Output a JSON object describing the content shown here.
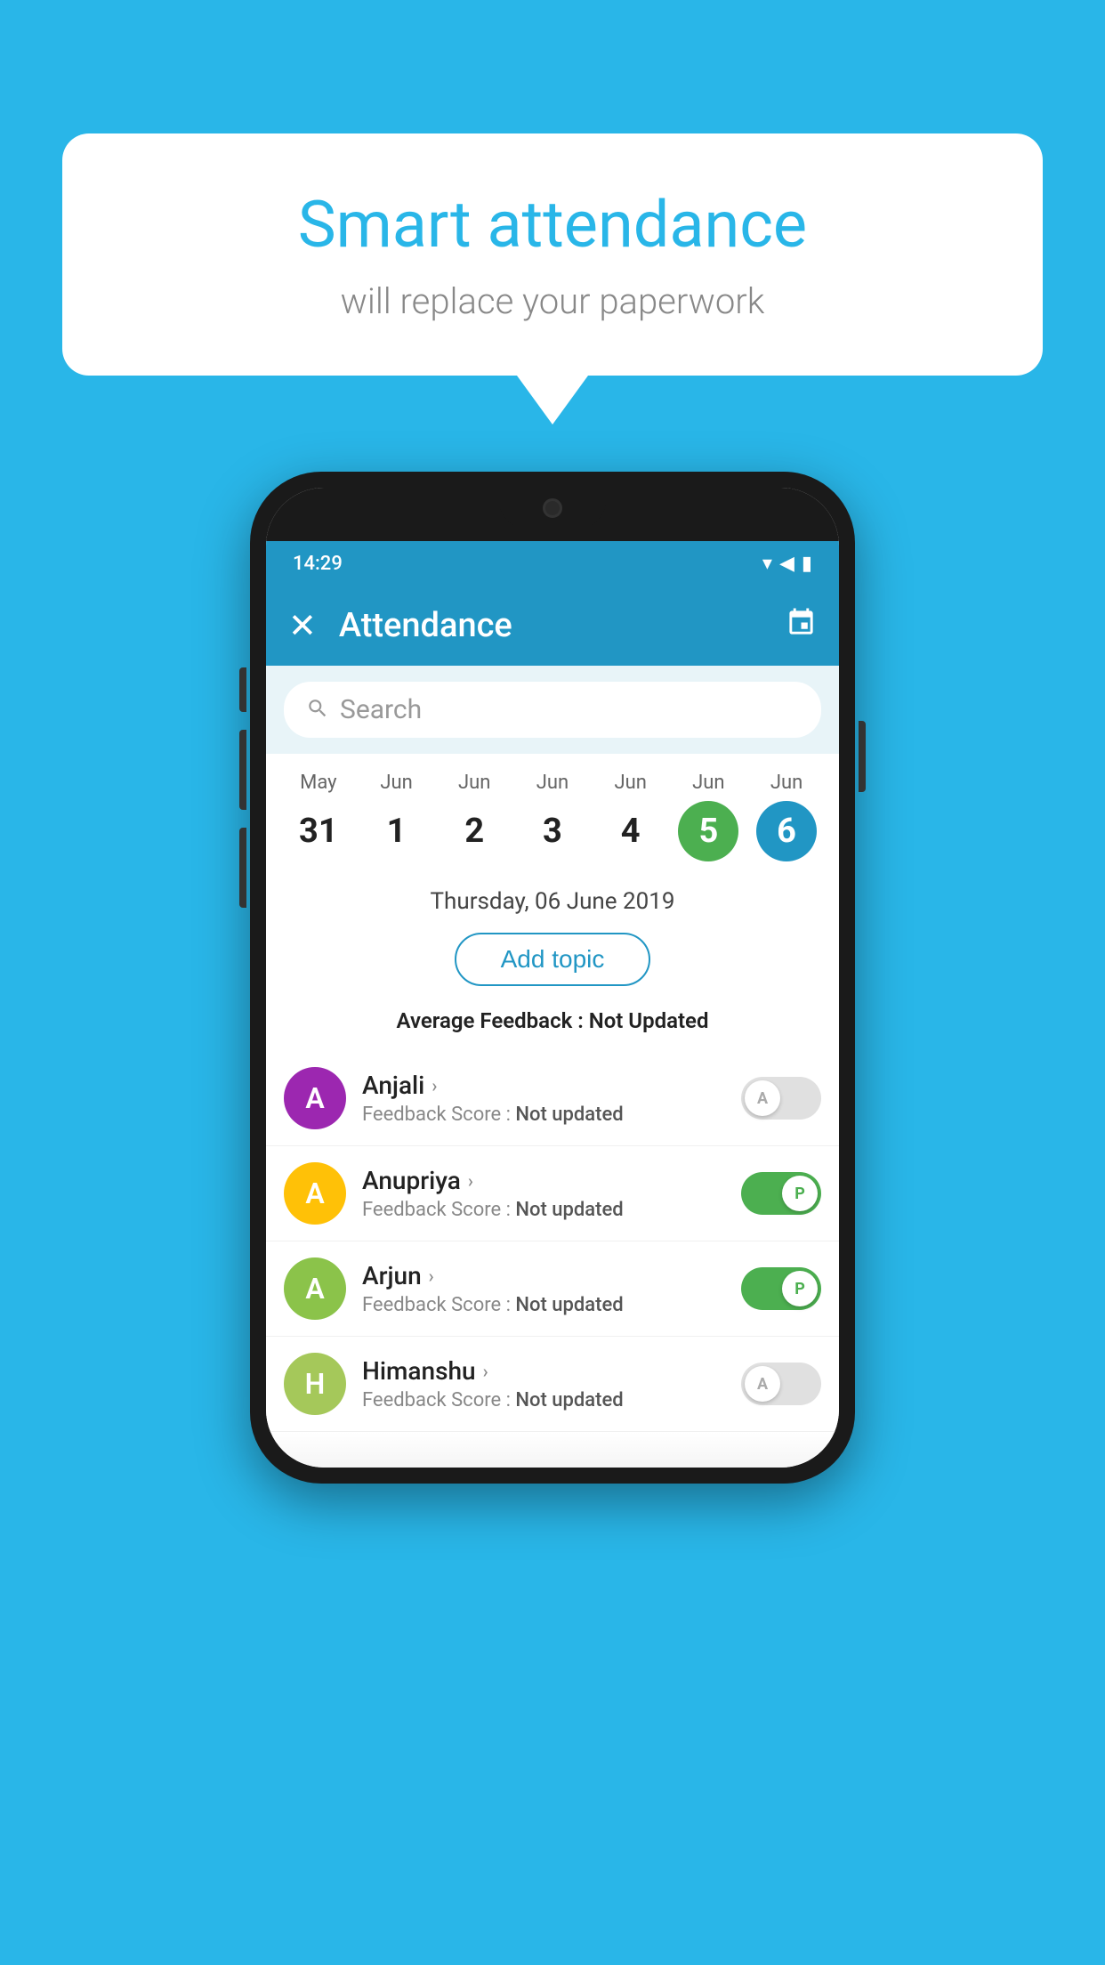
{
  "background_color": "#29b6e8",
  "speech_bubble": {
    "title": "Smart attendance",
    "subtitle": "will replace your paperwork"
  },
  "status_bar": {
    "time": "14:29",
    "wifi": "▾",
    "signal": "◀",
    "battery": "▮"
  },
  "app_bar": {
    "close_label": "✕",
    "title": "Attendance",
    "calendar_icon": "📅"
  },
  "search": {
    "placeholder": "Search"
  },
  "calendar": {
    "days": [
      {
        "month": "May",
        "date": "31",
        "state": "normal"
      },
      {
        "month": "Jun",
        "date": "1",
        "state": "normal"
      },
      {
        "month": "Jun",
        "date": "2",
        "state": "normal"
      },
      {
        "month": "Jun",
        "date": "3",
        "state": "normal"
      },
      {
        "month": "Jun",
        "date": "4",
        "state": "normal"
      },
      {
        "month": "Jun",
        "date": "5",
        "state": "today"
      },
      {
        "month": "Jun",
        "date": "6",
        "state": "selected"
      }
    ],
    "selected_date_label": "Thursday, 06 June 2019"
  },
  "add_topic": {
    "label": "Add topic"
  },
  "average_feedback": {
    "label": "Average Feedback : ",
    "value": "Not Updated"
  },
  "students": [
    {
      "name": "Anjali",
      "initial": "A",
      "avatar_color": "#9c27b0",
      "feedback": "Feedback Score : ",
      "feedback_value": "Not updated",
      "toggle_state": "off",
      "toggle_label": "A"
    },
    {
      "name": "Anupriya",
      "initial": "A",
      "avatar_color": "#ffc107",
      "feedback": "Feedback Score : ",
      "feedback_value": "Not updated",
      "toggle_state": "on",
      "toggle_label": "P"
    },
    {
      "name": "Arjun",
      "initial": "A",
      "avatar_color": "#8bc34a",
      "feedback": "Feedback Score : ",
      "feedback_value": "Not updated",
      "toggle_state": "on",
      "toggle_label": "P"
    },
    {
      "name": "Himanshu",
      "initial": "H",
      "avatar_color": "#a5c85a",
      "feedback": "Feedback Score : ",
      "feedback_value": "Not updated",
      "toggle_state": "off",
      "toggle_label": "A"
    }
  ]
}
